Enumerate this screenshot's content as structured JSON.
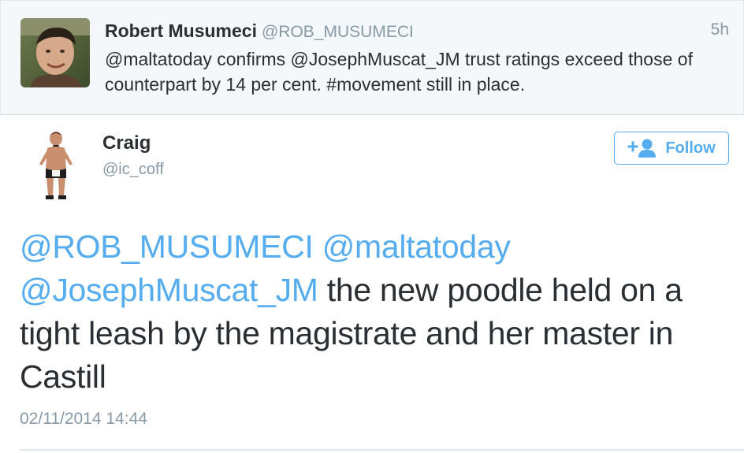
{
  "parent_tweet": {
    "author_name": "Robert Musumeci",
    "author_handle": "@ROB_MUSUMECI",
    "time": "5h",
    "text": "@maltatoday confirms @JosephMuscat_JM trust ratings exceed those of counterpart by 14 per cent. #movement still in place."
  },
  "main_tweet": {
    "author_name": "Craig",
    "author_handle": "@ic_coff",
    "follow_label": "Follow",
    "follow_icon": "add-user-icon",
    "mention_1": "@ROB_MUSUMECI",
    "mention_2": "@maltatoday",
    "mention_3": "@JosephMuscat_JM",
    "body_text": " the new poodle held on a tight leash by the magistrate and her master in Castill",
    "timestamp": "02/11/2014 14:44"
  },
  "colors": {
    "link_blue": "#55acee",
    "secondary_gray": "#8899a6",
    "text_dark": "#292f33",
    "parent_background": "#f5f8fa"
  }
}
